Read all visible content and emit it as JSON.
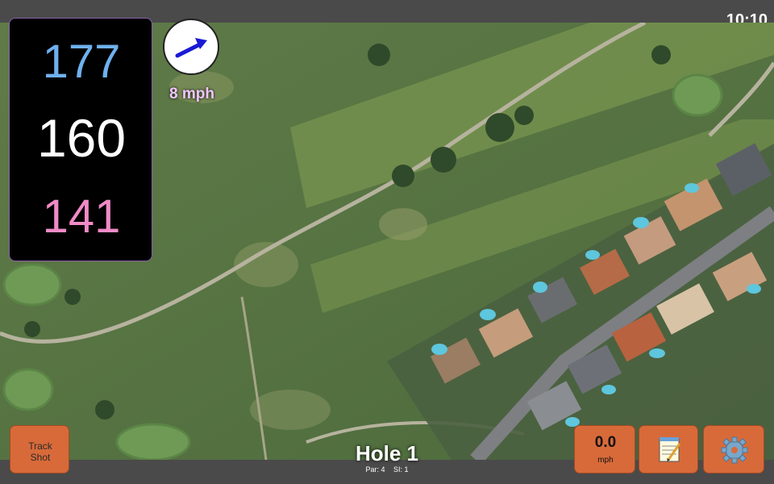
{
  "status_bar": {
    "time": "10:10"
  },
  "distances": {
    "back": "177",
    "middle": "160",
    "front": "141"
  },
  "wind": {
    "speed": "8 mph",
    "direction_icon": "wind-arrow-icon"
  },
  "buttons": {
    "track_shot": [
      "Track",
      "Shot"
    ],
    "speed": {
      "value": "0.0",
      "unit": "mph"
    },
    "notes_icon": "notepad-icon",
    "settings_icon": "gear-icon"
  },
  "hole": {
    "title": "Hole 1",
    "par": "Par: 4",
    "si": "SI: 1"
  },
  "colors": {
    "accent": "#d86a3a",
    "back": "#6fb0ee",
    "middle": "#ffffff",
    "front": "#ef8bc6"
  }
}
